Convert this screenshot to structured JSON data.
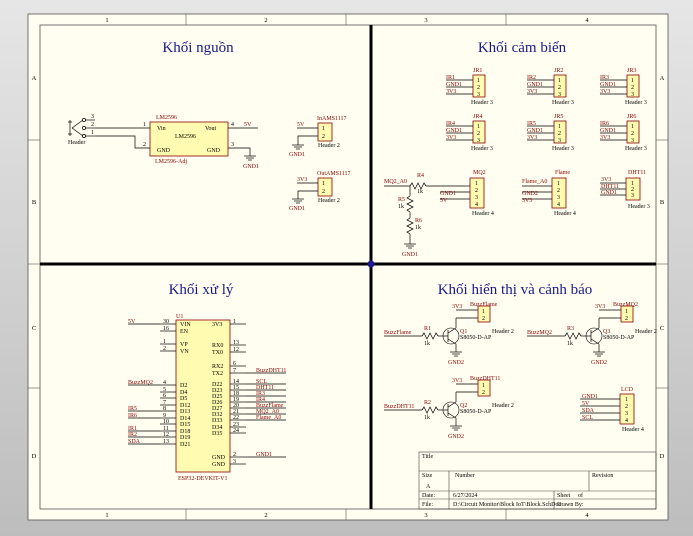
{
  "zones": {
    "columns": [
      "1",
      "2",
      "3",
      "4"
    ],
    "rows": [
      "A",
      "B",
      "C",
      "D"
    ]
  },
  "blocks": {
    "power": "Khối nguồn",
    "sensor": "Khối cảm biến",
    "processing": "Khối xử lý",
    "display": "Khối hiển thị và cảnh báo"
  },
  "power": {
    "header_ref": "Header",
    "header_pins": [
      "3",
      "2",
      "1"
    ],
    "reg_ref": "LM2596",
    "reg_name": "LM2596",
    "reg_value": "LM2596-Adj",
    "reg_pins": {
      "vin": "Vin",
      "vout": "Vout",
      "gnd_l": "GND",
      "gnd_r": "GND",
      "n1": "1",
      "n4": "4",
      "n2": "2",
      "n3": "3"
    },
    "out_net": "5V",
    "gnd1": "GND1",
    "in_ams": {
      "ref": "InAMS1117",
      "net": "5V",
      "gnd": "GND1",
      "value": "Header 2",
      "pins": [
        "1",
        "2"
      ]
    },
    "out_ams": {
      "ref": "OutAMS1117",
      "net": "3V3",
      "gnd": "GND1",
      "value": "Header 2",
      "pins": [
        "1",
        "2"
      ]
    }
  },
  "sensors": {
    "ir_headers": [
      {
        "ref": "IR1",
        "lbl": "JR1",
        "nets": [
          "GND1",
          "3V3"
        ]
      },
      {
        "ref": "IR2",
        "lbl": "JR2",
        "nets": [
          "GND1",
          "3V3"
        ]
      },
      {
        "ref": "IR3",
        "lbl": "JR3",
        "nets": [
          "GND1",
          "3V3"
        ]
      },
      {
        "ref": "IR4",
        "lbl": "JR4",
        "nets": [
          "GND1",
          "3V3"
        ]
      },
      {
        "ref": "IR5",
        "lbl": "JR5",
        "nets": [
          "GND1",
          "3V3"
        ]
      },
      {
        "ref": "IR6",
        "lbl": "JR6",
        "nets": [
          "GND1",
          "3V3"
        ]
      }
    ],
    "header3": "Header 3",
    "pins3": [
      "1",
      "2",
      "3"
    ],
    "mq2": {
      "ref": "MQ2",
      "net_in": "MQ2_A0",
      "r4": "R4",
      "r4v": "1k",
      "r5": "R5",
      "r5v": "1k",
      "r6": "R6",
      "r6v": "1k",
      "gnd": "GND1",
      "nets": [
        "GND1",
        "5V"
      ],
      "value": "Header 4",
      "pins": [
        "1",
        "2",
        "3",
        "4"
      ],
      "gnd_bottom": "GND1"
    },
    "flame": {
      "ref": "Flame",
      "net": "Flame_A0",
      "nets": [
        "GND2",
        "3V3"
      ],
      "value": "Header 4",
      "pins": [
        "1",
        "2",
        "3",
        "4"
      ]
    },
    "dht": {
      "ref": "DHT11",
      "nets": [
        "3V3",
        "DHT11",
        "GND1"
      ],
      "value": "Header 3",
      "pins": [
        "1",
        "2",
        "3"
      ]
    }
  },
  "mcu": {
    "ref": "U1",
    "value": "ESP32-DEVKIT-V1",
    "left_pins": [
      {
        "num": "30",
        "name": "VIN",
        "net": "5V"
      },
      {
        "num": "16",
        "name": "EN",
        "net": ""
      },
      {
        "num": "1",
        "name": "VP",
        "net": ""
      },
      {
        "num": "2",
        "name": "VN",
        "net": ""
      },
      {
        "num": "4",
        "name": "D2",
        "net": "BuzzMQ2"
      },
      {
        "num": "5",
        "name": "D4",
        "net": ""
      },
      {
        "num": "6",
        "name": "D5",
        "net": ""
      },
      {
        "num": "7",
        "name": "D12",
        "net": ""
      },
      {
        "num": "8",
        "name": "D13",
        "net": "IR5"
      },
      {
        "num": "9",
        "name": "D14",
        "net": "IR6"
      },
      {
        "num": "10",
        "name": "D15",
        "net": ""
      },
      {
        "num": "11",
        "name": "D18",
        "net": "IR1"
      },
      {
        "num": "12",
        "name": "D19",
        "net": "IR2"
      },
      {
        "num": "13",
        "name": "D21",
        "net": "SDA"
      }
    ],
    "right_pins": [
      {
        "num": "1",
        "name": "3V3",
        "net": ""
      },
      {
        "num": "13",
        "name": "RX0",
        "net": ""
      },
      {
        "num": "12",
        "name": "TX0",
        "net": ""
      },
      {
        "num": "6",
        "name": "RX2",
        "net": ""
      },
      {
        "num": "7",
        "name": "TX2",
        "net": "BuzzDHT11"
      },
      {
        "num": "14",
        "name": "D22",
        "net": "SCL"
      },
      {
        "num": "15",
        "name": "D23",
        "net": "DHT11"
      },
      {
        "num": "18",
        "name": "D25",
        "net": "IR3"
      },
      {
        "num": "19",
        "name": "D26",
        "net": "IR4"
      },
      {
        "num": "20",
        "name": "D27",
        "net": "BuzzFlame"
      },
      {
        "num": "21",
        "name": "D32",
        "net": "MQ2_A0"
      },
      {
        "num": "22",
        "name": "D33",
        "net": "Flame_A0"
      },
      {
        "num": "23",
        "name": "D34",
        "net": ""
      },
      {
        "num": "24",
        "name": "D35",
        "net": ""
      },
      {
        "num": "2",
        "name": "GND",
        "net": "GND1"
      },
      {
        "num": "3",
        "name": "GND",
        "net": ""
      }
    ]
  },
  "alarm": {
    "q1": {
      "in": "BuzzFlame",
      "r": "R1",
      "rv": "1k",
      "q": "Q1",
      "qv": "S8050-D-AP",
      "vcc": "3V3",
      "gnd": "GND2",
      "hdr": "BuzzFlame",
      "hdrv": "Header 2"
    },
    "q3": {
      "in": "BuzzMQ2",
      "r": "R3",
      "rv": "1k",
      "q": "Q3",
      "qv": "S8050-D-AP",
      "vcc": "3V3",
      "gnd": "GND2",
      "hdr": "BuzzMQ2",
      "hdrv": "Header 2"
    },
    "q2": {
      "in": "BuzzDHT11",
      "r": "R2",
      "rv": "1k",
      "q": "Q2",
      "qv": "S8050-D-AP",
      "vcc": "3V3",
      "gnd": "GND2",
      "hdr": "BuzzDHT11",
      "hdrv": "Header 2"
    },
    "pins2": [
      "1",
      "2"
    ],
    "lcd": {
      "ref": "LCD",
      "value": "Header 4",
      "nets": [
        "GND1",
        "5V",
        "SDA",
        "SCL"
      ],
      "pins": [
        "1",
        "2",
        "3",
        "4"
      ]
    }
  },
  "title_block": {
    "title": "Title",
    "size_lbl": "Size",
    "size": "A",
    "number_lbl": "Number",
    "revision_lbl": "Revision",
    "date_lbl": "Date:",
    "date": "6/27/2024",
    "sheet_lbl": "Sheet",
    "of_lbl": "of",
    "file_lbl": "File:",
    "file": "D:\\Circuit Monitor\\Block IoT\\Block.SchDoc",
    "drawn_lbl": "Drawn By:"
  }
}
